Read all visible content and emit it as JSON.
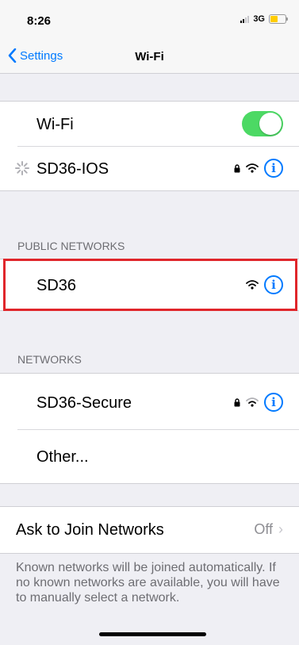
{
  "status_bar": {
    "time": "8:26",
    "network": "3G",
    "battery_color": "#ffcc00",
    "battery_level": 0.5
  },
  "nav": {
    "back_label": "Settings",
    "title": "Wi-Fi"
  },
  "wifi_toggle": {
    "label": "Wi-Fi",
    "on": true,
    "color": "#4cd964"
  },
  "current_network": {
    "name": "SD36-IOS",
    "secured": true,
    "connecting": true
  },
  "public_networks": {
    "header": "PUBLIC NETWORKS",
    "items": [
      {
        "name": "SD36",
        "secured": false
      }
    ]
  },
  "networks": {
    "header": "NETWORKS",
    "items": [
      {
        "name": "SD36-Secure",
        "secured": true
      }
    ],
    "other_label": "Other..."
  },
  "ask_to_join": {
    "label": "Ask to Join Networks",
    "value": "Off"
  },
  "footer": "Known networks will be joined automatically. If no known networks are available, you will have to manually select a network.",
  "colors": {
    "accent": "#007aff",
    "highlight_border": "#e0262b"
  }
}
